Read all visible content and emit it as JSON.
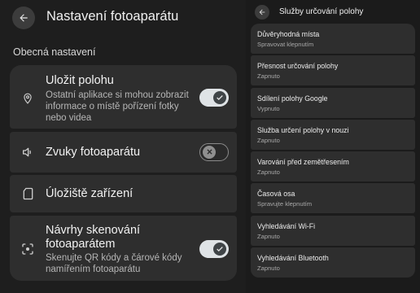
{
  "left_panel": {
    "title": "Nastavení fotoaparátu",
    "section_header": "Obecná nastavení",
    "settings": [
      {
        "title": "Uložit polohu",
        "subtitle_lines": [
          "Ostatní aplikace si mohou zobrazit",
          "informace o místě pořízení fotky",
          "nebo videa"
        ],
        "icon": "location-pin-icon",
        "toggle": "on"
      },
      {
        "title": "Zvuky fotoaparátu",
        "icon": "speaker-icon",
        "toggle": "off"
      },
      {
        "title": "Úložiště zařízení",
        "icon": "sd-card-icon"
      },
      {
        "title_lines": [
          "Návrhy skenování",
          "fotoaparátem"
        ],
        "subtitle_lines": [
          "Skenujte QR kódy a čárové kódy",
          "namířením fotoaparátu"
        ],
        "icon": "scan-lens-icon",
        "toggle": "on"
      }
    ]
  },
  "right_panel": {
    "title": "Služby určování polohy",
    "items": [
      {
        "title": "Důvěryhodná místa",
        "subtitle": "Spravovat klepnutím"
      },
      {
        "title": "Přesnost určování polohy",
        "subtitle": "Zapnuto"
      },
      {
        "title": "Sdílení polohy Google",
        "subtitle": "Vypnuto"
      },
      {
        "title": "Služba určení polohy v nouzi",
        "subtitle": "Zapnuto"
      },
      {
        "title": "Varování před zemětřesením",
        "subtitle": "Zapnuto"
      },
      {
        "title": "Časová osa",
        "subtitle": "Spravujte klepnutím"
      },
      {
        "title": "Vyhledávání Wi-Fi",
        "subtitle": "Zapnuto"
      },
      {
        "title": "Vyhledávání Bluetooth",
        "subtitle": "Zapnuto"
      }
    ]
  },
  "colors": {
    "background": "#1e1e1e",
    "card": "#2e2e2e",
    "toggle_on_track": "#dfe3e6",
    "toggle_on_knob": "#3f4447"
  }
}
